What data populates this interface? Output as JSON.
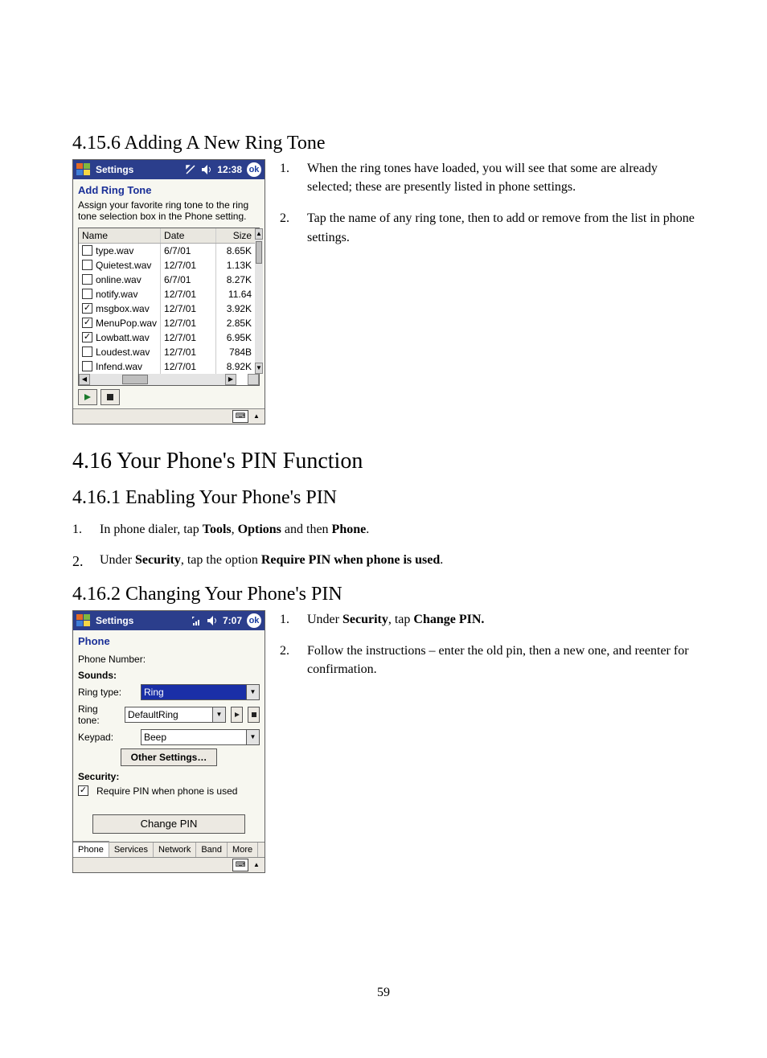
{
  "headings": {
    "h_4156": "4.15.6 Adding A New Ring Tone",
    "h_416": "4.16  Your Phone's PIN Function",
    "h_4161": "4.16.1 Enabling Your Phone's PIN",
    "h_4162": "4.16.2 Changing Your Phone's PIN"
  },
  "page_number": "59",
  "shot1": {
    "titlebar": {
      "title": "Settings",
      "time": "12:38",
      "ok": "ok"
    },
    "subtitle": "Add Ring Tone",
    "desc": "Assign your favorite ring tone to the ring tone selection box in the Phone setting.",
    "columns": {
      "name": "Name",
      "date": "Date",
      "size": "Size"
    },
    "rows": [
      {
        "checked": false,
        "name": "type.wav",
        "date": "6/7/01",
        "size": "8.65K"
      },
      {
        "checked": false,
        "name": "Quietest.wav",
        "date": "12/7/01",
        "size": "1.13K"
      },
      {
        "checked": false,
        "name": "online.wav",
        "date": "6/7/01",
        "size": "8.27K"
      },
      {
        "checked": false,
        "name": "notify.wav",
        "date": "12/7/01",
        "size": "11.64"
      },
      {
        "checked": true,
        "name": "msgbox.wav",
        "date": "12/7/01",
        "size": "3.92K"
      },
      {
        "checked": true,
        "name": "MenuPop.wav",
        "date": "12/7/01",
        "size": "2.85K"
      },
      {
        "checked": true,
        "name": "Lowbatt.wav",
        "date": "12/7/01",
        "size": "6.95K"
      },
      {
        "checked": false,
        "name": "Loudest.wav",
        "date": "12/7/01",
        "size": "784B"
      },
      {
        "checked": false,
        "name": "Infend.wav",
        "date": "12/7/01",
        "size": "8.92K"
      }
    ]
  },
  "instr1": {
    "items": [
      "When the ring tones have loaded, you will see that some are already selected; these are presently listed in phone settings.",
      "Tap the name of any ring tone, then to add or remove from the list in phone settings."
    ]
  },
  "enable_steps": {
    "s1_pre": "In phone dialer, tap ",
    "s1_b1": "Tools",
    "s1_mid1": ", ",
    "s1_b2": "Options",
    "s1_mid2": " and then ",
    "s1_b3": "Phone",
    "s1_end": ".",
    "s2_pre": "Under ",
    "s2_b1": "Security",
    "s2_mid": ", tap the option ",
    "s2_b2": "Require PIN when phone is used",
    "s2_end": "."
  },
  "shot2": {
    "titlebar": {
      "title": "Settings",
      "time": "7:07",
      "ok": "ok"
    },
    "header": "Phone",
    "phone_number_label": "Phone Number:",
    "sounds_label": "Sounds:",
    "ring_type_label": "Ring type:",
    "ring_type_value": "Ring",
    "ring_tone_label": "Ring tone:",
    "ring_tone_value": "DefaultRing",
    "keypad_label": "Keypad:",
    "keypad_value": "Beep",
    "other_settings": "Other Settings…",
    "security_label": "Security:",
    "require_pin": "Require PIN when phone is used",
    "change_pin": "Change PIN",
    "tabs": [
      "Phone",
      "Services",
      "Network",
      "Band",
      "More"
    ]
  },
  "instr2": {
    "s1_pre": "Under ",
    "s1_b1": "Security",
    "s1_mid": ", tap ",
    "s1_b2": "Change PIN.",
    "s2": "Follow the instructions – enter the old pin, then a new one, and reenter for confirmation."
  }
}
